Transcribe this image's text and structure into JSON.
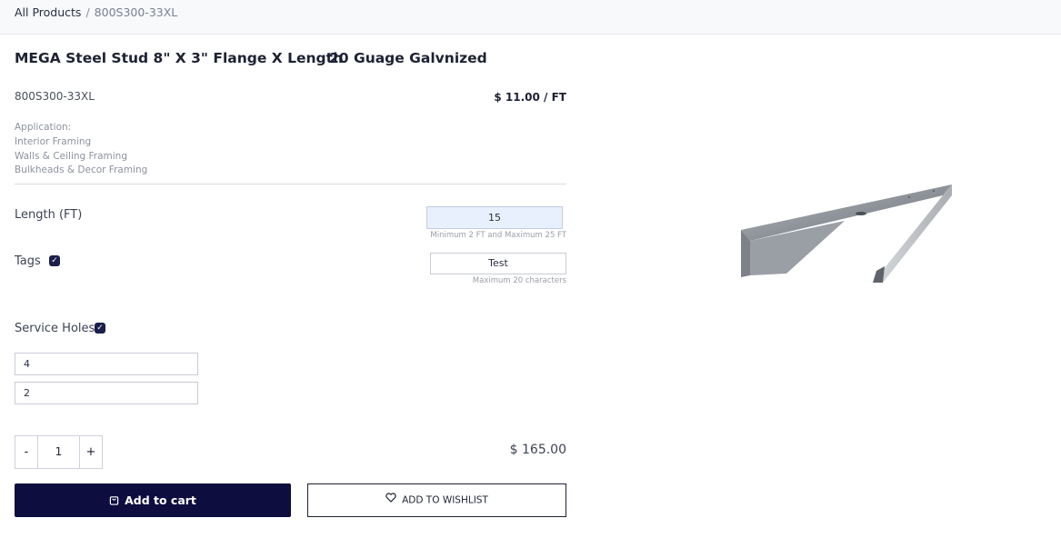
{
  "breadcrumb": {
    "root": "All Products",
    "separator": "/",
    "current": "800S300-33XL"
  },
  "product": {
    "title": "MEGA Steel Stud 8\" X 3\" Flange X Length",
    "subtitle": "20 Guage Galvnized",
    "sku": "800S300-33XL",
    "unit_price": "$ 11.00 / FT",
    "application": [
      "Application:",
      "Interior Framing",
      "Walls & Ceiling Framing",
      "Bulkheads & Decor Framing"
    ],
    "image_alt": "steel-stud-image"
  },
  "length": {
    "label": "Length (FT)",
    "value": "15",
    "hint": "Minimum 2 FT and Maximum 25 FT"
  },
  "tags": {
    "label": "Tags",
    "checked": true,
    "value": "Test",
    "hint": "Maximum 20 characters"
  },
  "service_holes": {
    "label": "Service Holes",
    "checked": true,
    "values": [
      "4",
      "2"
    ]
  },
  "quantity": {
    "minus": "-",
    "value": "1",
    "plus": "+"
  },
  "total": "$ 165.00",
  "actions": {
    "add_to_cart": "Add to cart",
    "add_to_wishlist": "ADD TO WISHLIST"
  },
  "icons": {
    "check": "checkmark-icon",
    "cart": "bag-icon",
    "wishlist": "heart-icon"
  },
  "colors": {
    "primary": "#0e0d3f",
    "checkbox": "#1b1f4a",
    "length_field_bg": "#e8effd"
  }
}
